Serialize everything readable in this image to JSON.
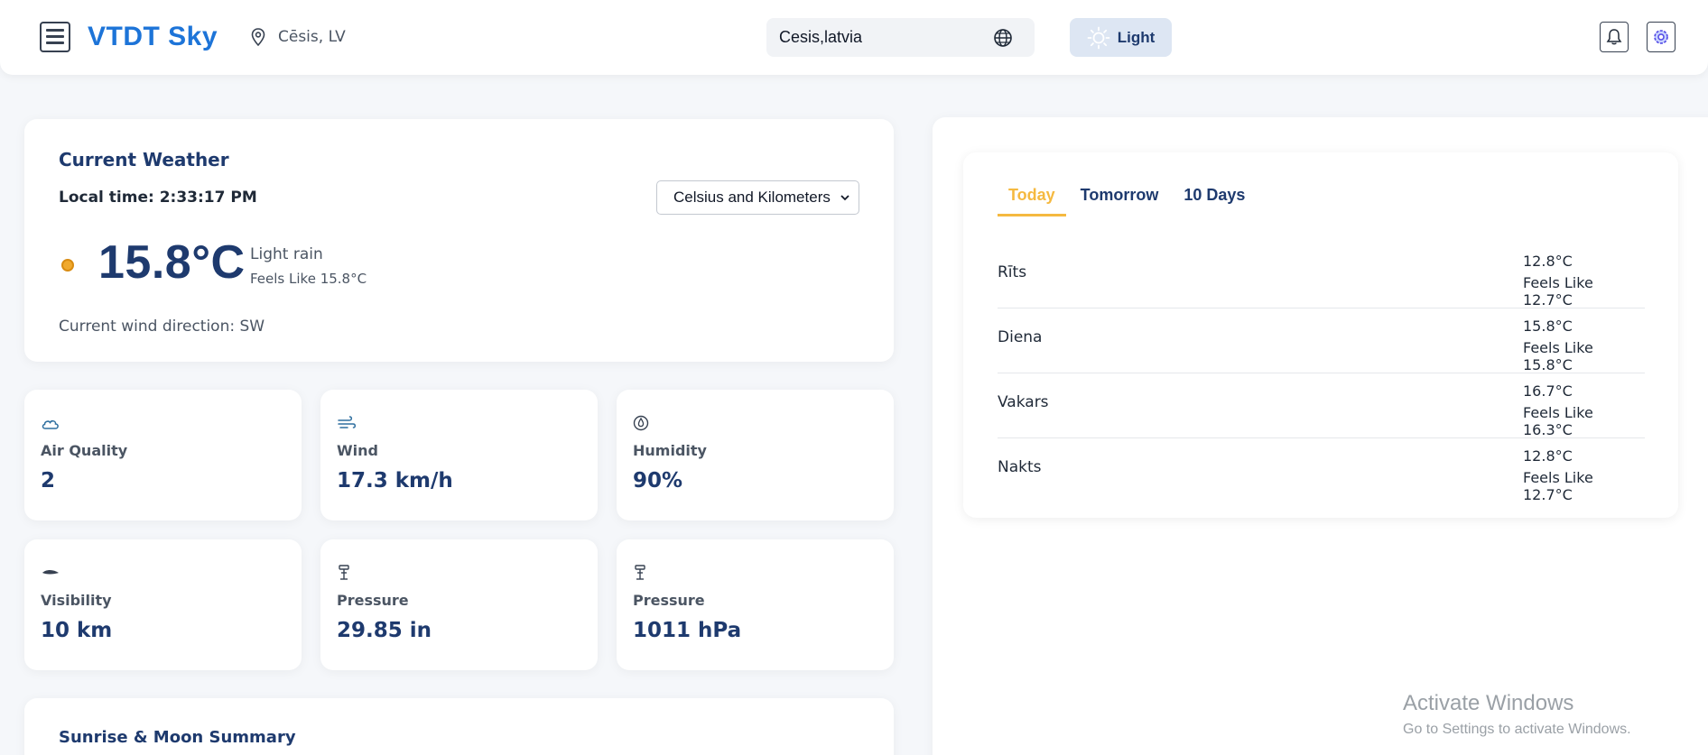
{
  "header": {
    "brand": "VTDT Sky",
    "location": "Cēsis, LV",
    "search_value": "Cesis,latvia",
    "theme_label": "Light"
  },
  "current": {
    "title": "Current Weather",
    "local_time": "Local time: 2:33:17 PM",
    "unit_selected": "Celsius and Kilometers",
    "temperature": "15.8°C",
    "condition": "Light rain",
    "feels_like": "Feels Like 15.8°C",
    "wind_direction": "Current wind direction: SW"
  },
  "stats": [
    {
      "label": "Air Quality",
      "value": "2",
      "icon": "cloud-icon"
    },
    {
      "label": "Wind",
      "value": "17.3 km/h",
      "icon": "wind-icon"
    },
    {
      "label": "Humidity",
      "value": "90%",
      "icon": "humidity-icon"
    },
    {
      "label": "Visibility",
      "value": "10 km",
      "icon": "visibility-icon"
    },
    {
      "label": "Pressure",
      "value": "29.85 in",
      "icon": "pressure-icon"
    },
    {
      "label": "Pressure",
      "value": "1011 hPa",
      "icon": "pressure-icon"
    }
  ],
  "sunrise": {
    "title": "Sunrise & Moon Summary"
  },
  "forecast": {
    "tabs": [
      "Today",
      "Tomorrow",
      "10 Days"
    ],
    "active_tab": "Today",
    "rows": [
      {
        "period": "Rīts",
        "temp": "12.8°C",
        "feels": "Feels Like 12.7°C"
      },
      {
        "period": "Diena",
        "temp": "15.8°C",
        "feels": "Feels Like 15.8°C"
      },
      {
        "period": "Vakars",
        "temp": "16.7°C",
        "feels": "Feels Like 16.3°C"
      },
      {
        "period": "Nakts",
        "temp": "12.8°C",
        "feels": "Feels Like 12.7°C"
      }
    ]
  },
  "watermark": {
    "line1": "Activate Windows",
    "line2": "Go to Settings to activate Windows."
  },
  "colors": {
    "brand": "#1d74d8",
    "accent_tab": "#f5b940",
    "heading": "#1e3a6e"
  }
}
